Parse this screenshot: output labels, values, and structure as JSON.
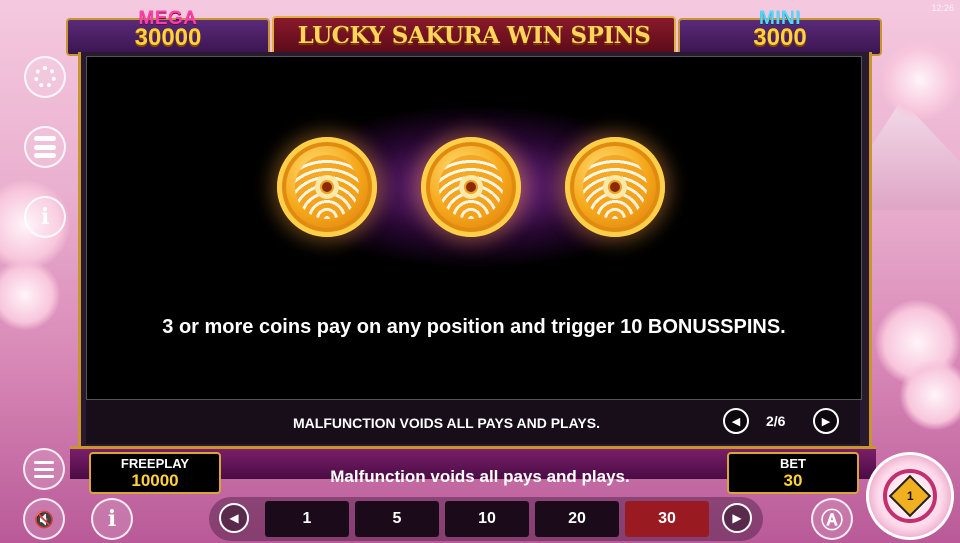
{
  "status_bar": {
    "clock": "12:26"
  },
  "jackpots": {
    "mega": {
      "label": "MEGA",
      "value": "30000"
    },
    "mini": {
      "label": "MINI",
      "value": "3000"
    }
  },
  "game_title": "LUCKY SAKURA WIN SPINS",
  "side_menu": {
    "settings_icon": "gear-icon",
    "coins_icon": "coin-stack-icon",
    "info_icon": "info-icon",
    "menu_icon": "menu-icon",
    "sound_icon": "sound-off-icon",
    "help_icon": "info-icon",
    "info_glyph": "i",
    "sound_glyph": "🔇"
  },
  "info_panel": {
    "description": "3 or more coins pay on any position and trigger 10 BONUSSPINS.",
    "notice": "MALFUNCTION VOIDS ALL PAYS AND PLAYS.",
    "page": "2/6",
    "prev_glyph": "◀",
    "next_glyph": "▶"
  },
  "bottom": {
    "message": "Malfunction voids all pays and plays.",
    "freeplay": {
      "label": "FREEPLAY",
      "value": "10000"
    },
    "bet": {
      "label": "BET",
      "value": "30"
    },
    "bet_options": [
      "1",
      "5",
      "10",
      "20",
      "30"
    ],
    "selected_bet": "30",
    "autoplay_glyph": "Ⓐ",
    "spin_label": "1"
  },
  "colors": {
    "accent_gold": "#c9962e",
    "selected_bet": "#9a1a22",
    "mega": "#ff3fa8",
    "mini": "#4fd9ff"
  }
}
